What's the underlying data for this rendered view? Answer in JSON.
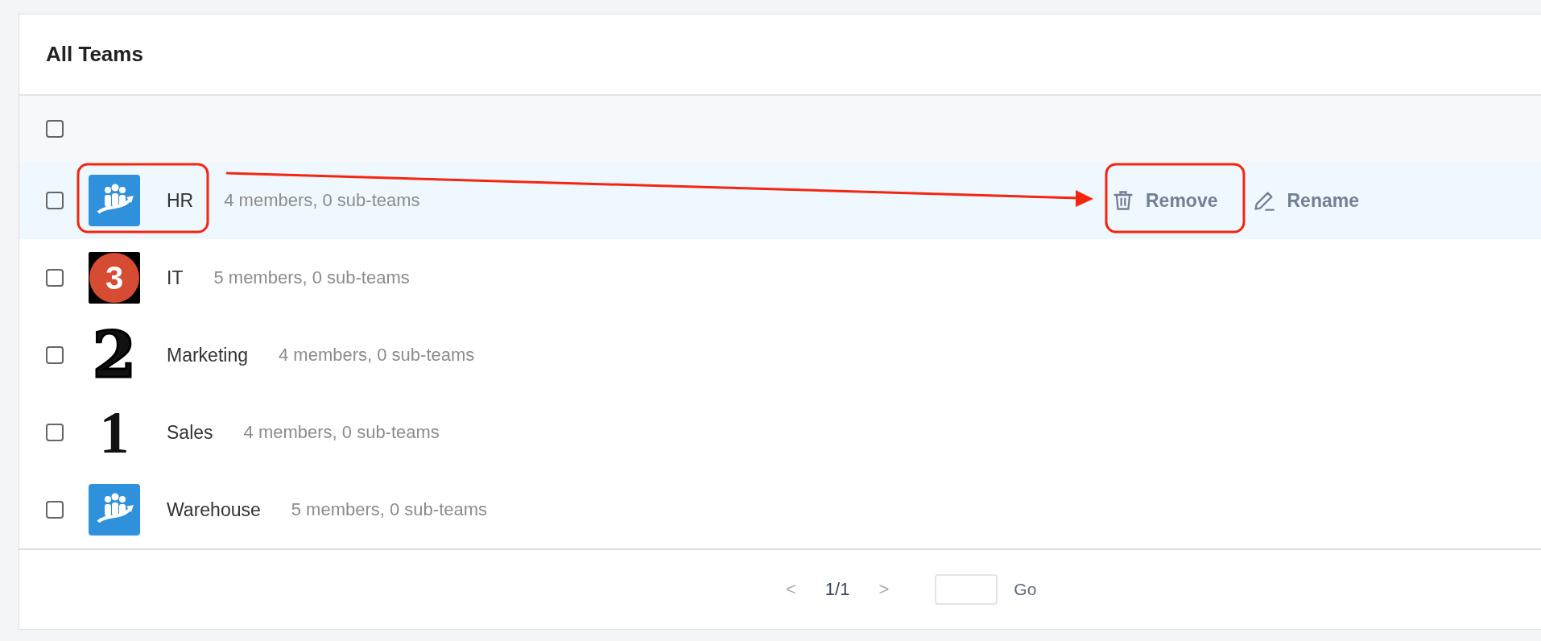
{
  "panel": {
    "title": "All Teams"
  },
  "select_all": {
    "checked": false
  },
  "teams": [
    {
      "name": "HR",
      "summary": "4 members, 0 sub-teams",
      "checked": false,
      "highlighted": true,
      "avatar": {
        "kind": "people-logo"
      },
      "actions": [
        {
          "label": "Remove",
          "kind": "remove"
        },
        {
          "label": "Rename",
          "kind": "rename"
        }
      ]
    },
    {
      "name": "IT",
      "summary": "5 members, 0 sub-teams",
      "checked": false,
      "highlighted": false,
      "avatar": {
        "kind": "circle-digit",
        "text": "3"
      }
    },
    {
      "name": "Marketing",
      "summary": "4 members, 0 sub-teams",
      "checked": false,
      "highlighted": false,
      "avatar": {
        "kind": "outline-digit",
        "text": "2"
      }
    },
    {
      "name": "Sales",
      "summary": "4 members, 0 sub-teams",
      "checked": false,
      "highlighted": false,
      "avatar": {
        "kind": "serif-digit",
        "text": "1"
      }
    },
    {
      "name": "Warehouse",
      "summary": "5 members, 0 sub-teams",
      "checked": false,
      "highlighted": false,
      "avatar": {
        "kind": "people-logo"
      }
    }
  ],
  "pagination": {
    "prev": "<",
    "page": "1/1",
    "next": ">",
    "go": "Go"
  }
}
